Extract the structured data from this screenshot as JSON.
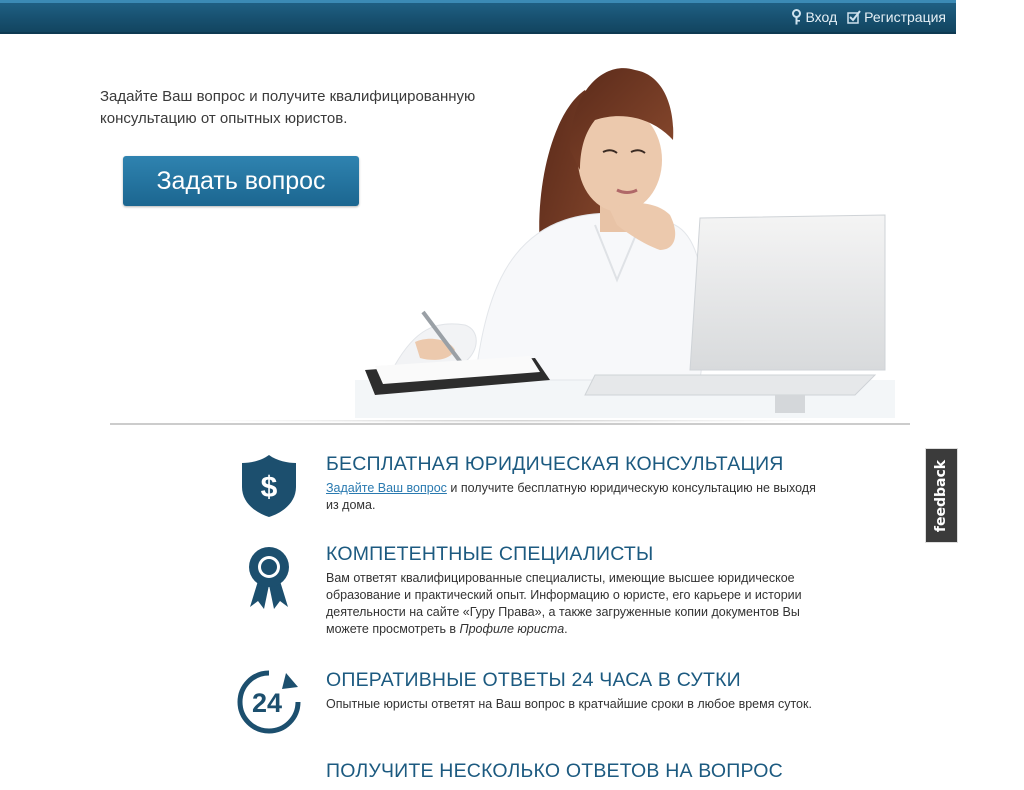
{
  "header": {
    "login_label": "Вход",
    "register_label": "Регистрация"
  },
  "hero": {
    "text": "Задайте Ваш вопрос и получите квалифицированную консультацию от опытных юристов.",
    "ask_button_label": "Задать вопрос"
  },
  "features": [
    {
      "icon": "dollar-shield-icon",
      "title": "БЕСПЛАТНАЯ ЮРИДИЧЕСКАЯ КОНСУЛЬТАЦИЯ",
      "link_text": "Задайте Ваш вопрос",
      "text": " и получите бесплатную юридическую консультацию не выходя из дома."
    },
    {
      "icon": "award-ribbon-icon",
      "title": "КОМПЕТЕНТНЫЕ СПЕЦИАЛИСТЫ",
      "text": "Вам ответят квалифицированные специалисты, имеющие высшее юридическое образование и практический опыт. Информацию о юристе, его карьере и истории деятельности на сайте «Гуру Права», а также загруженные копии документов Вы можете просмотреть в ",
      "italic_text": "Профиле юриста",
      "text_end": "."
    },
    {
      "icon": "24-hours-icon",
      "title": "ОПЕРАТИВНЫЕ ОТВЕТЫ 24 ЧАСА В СУТКИ",
      "text": "Опытные юристы ответят на Ваш вопрос в кратчайшие сроки в любое время суток."
    },
    {
      "title": "ПОЛУЧИТЕ НЕСКОЛЬКО ОТВЕТОВ НА ВОПРОС"
    }
  ],
  "feedback": {
    "label": "feedback"
  },
  "colors": {
    "topbar": "#17506f",
    "accent": "#1c5a80",
    "button": "#2f83b0",
    "link": "#2a7ab0",
    "feedback_bg": "#3b3b3b"
  }
}
